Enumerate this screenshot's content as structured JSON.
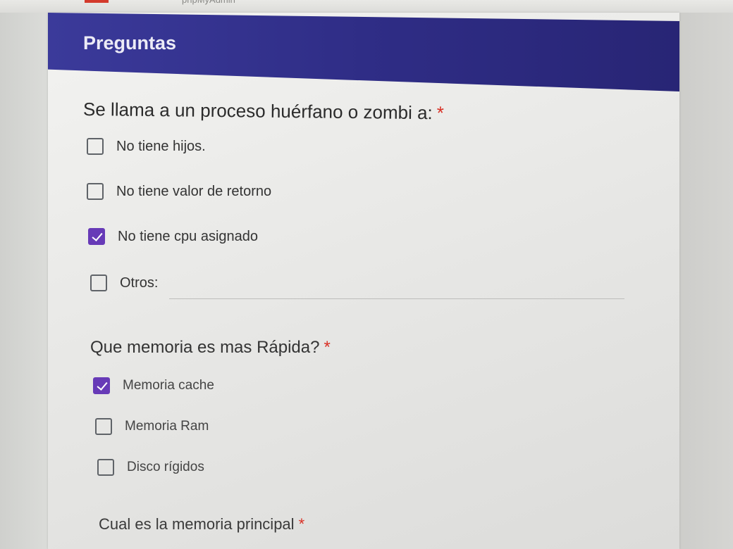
{
  "browser": {
    "tab_label": "phpMyAdmin"
  },
  "form": {
    "section_title": "Preguntas",
    "accent_color": "#673ab7",
    "header_color": "#2f2d86",
    "required_mark": "*",
    "questions": [
      {
        "text": "Se llama a un proceso huérfano o zombi a:",
        "required": true,
        "options": [
          {
            "label": "No tiene hijos.",
            "checked": false
          },
          {
            "label": "No tiene valor de retorno",
            "checked": false
          },
          {
            "label": "No tiene cpu asignado",
            "checked": true
          },
          {
            "label": "Otros:",
            "checked": false,
            "other_value": ""
          }
        ]
      },
      {
        "text": "Que memoria es mas Rápida?",
        "required": true,
        "options": [
          {
            "label": "Memoria cache",
            "checked": true
          },
          {
            "label": "Memoria Ram",
            "checked": false
          },
          {
            "label": "Disco rígidos",
            "checked": false
          }
        ]
      },
      {
        "text": "Cual es la memoria principal",
        "required": true,
        "options": []
      }
    ]
  }
}
